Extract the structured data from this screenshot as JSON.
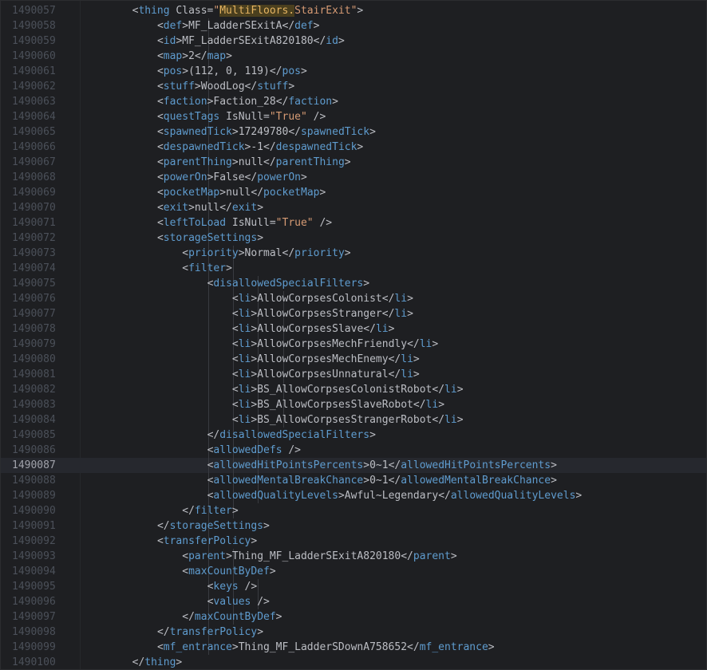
{
  "current_line": "1490087",
  "lines": [
    {
      "n": "1490057",
      "indent": 5,
      "parts": [
        [
          "br",
          "<"
        ],
        [
          "tag",
          "thing "
        ],
        [
          "attr",
          "Class="
        ],
        [
          "val",
          "\""
        ],
        [
          "hl",
          "MultiFloors."
        ],
        [
          "val",
          "StairExit\""
        ],
        [
          "br",
          ">"
        ]
      ]
    },
    {
      "n": "1490058",
      "indent": 6,
      "parts": [
        [
          "br",
          "<"
        ],
        [
          "tag",
          "def"
        ],
        [
          "br",
          ">"
        ],
        [
          "txt",
          "MF_LadderSExitA"
        ],
        [
          "br",
          "</"
        ],
        [
          "tag",
          "def"
        ],
        [
          "br",
          ">"
        ]
      ]
    },
    {
      "n": "1490059",
      "indent": 6,
      "parts": [
        [
          "br",
          "<"
        ],
        [
          "tag",
          "id"
        ],
        [
          "br",
          ">"
        ],
        [
          "txt",
          "MF_LadderSExitA820180"
        ],
        [
          "br",
          "</"
        ],
        [
          "tag",
          "id"
        ],
        [
          "br",
          ">"
        ]
      ]
    },
    {
      "n": "1490060",
      "indent": 6,
      "parts": [
        [
          "br",
          "<"
        ],
        [
          "tag",
          "map"
        ],
        [
          "br",
          ">"
        ],
        [
          "txt",
          "2"
        ],
        [
          "br",
          "</"
        ],
        [
          "tag",
          "map"
        ],
        [
          "br",
          ">"
        ]
      ]
    },
    {
      "n": "1490061",
      "indent": 6,
      "parts": [
        [
          "br",
          "<"
        ],
        [
          "tag",
          "pos"
        ],
        [
          "br",
          ">"
        ],
        [
          "txt",
          "(112, 0, 119)"
        ],
        [
          "br",
          "</"
        ],
        [
          "tag",
          "pos"
        ],
        [
          "br",
          ">"
        ]
      ]
    },
    {
      "n": "1490062",
      "indent": 6,
      "parts": [
        [
          "br",
          "<"
        ],
        [
          "tag",
          "stuff"
        ],
        [
          "br",
          ">"
        ],
        [
          "txt",
          "WoodLog"
        ],
        [
          "br",
          "</"
        ],
        [
          "tag",
          "stuff"
        ],
        [
          "br",
          ">"
        ]
      ]
    },
    {
      "n": "1490063",
      "indent": 6,
      "parts": [
        [
          "br",
          "<"
        ],
        [
          "tag",
          "faction"
        ],
        [
          "br",
          ">"
        ],
        [
          "txt",
          "Faction_28"
        ],
        [
          "br",
          "</"
        ],
        [
          "tag",
          "faction"
        ],
        [
          "br",
          ">"
        ]
      ]
    },
    {
      "n": "1490064",
      "indent": 6,
      "parts": [
        [
          "br",
          "<"
        ],
        [
          "tag",
          "questTags "
        ],
        [
          "attr",
          "IsNull="
        ],
        [
          "val",
          "\"True\""
        ],
        [
          "br",
          " />"
        ]
      ]
    },
    {
      "n": "1490065",
      "indent": 6,
      "parts": [
        [
          "br",
          "<"
        ],
        [
          "tag",
          "spawnedTick"
        ],
        [
          "br",
          ">"
        ],
        [
          "txt",
          "17249780"
        ],
        [
          "br",
          "</"
        ],
        [
          "tag",
          "spawnedTick"
        ],
        [
          "br",
          ">"
        ]
      ]
    },
    {
      "n": "1490066",
      "indent": 6,
      "parts": [
        [
          "br",
          "<"
        ],
        [
          "tag",
          "despawnedTick"
        ],
        [
          "br",
          ">"
        ],
        [
          "txt",
          "-1"
        ],
        [
          "br",
          "</"
        ],
        [
          "tag",
          "despawnedTick"
        ],
        [
          "br",
          ">"
        ]
      ]
    },
    {
      "n": "1490067",
      "indent": 6,
      "parts": [
        [
          "br",
          "<"
        ],
        [
          "tag",
          "parentThing"
        ],
        [
          "br",
          ">"
        ],
        [
          "txt",
          "null"
        ],
        [
          "br",
          "</"
        ],
        [
          "tag",
          "parentThing"
        ],
        [
          "br",
          ">"
        ]
      ]
    },
    {
      "n": "1490068",
      "indent": 6,
      "parts": [
        [
          "br",
          "<"
        ],
        [
          "tag",
          "powerOn"
        ],
        [
          "br",
          ">"
        ],
        [
          "txt",
          "False"
        ],
        [
          "br",
          "</"
        ],
        [
          "tag",
          "powerOn"
        ],
        [
          "br",
          ">"
        ]
      ]
    },
    {
      "n": "1490069",
      "indent": 6,
      "parts": [
        [
          "br",
          "<"
        ],
        [
          "tag",
          "pocketMap"
        ],
        [
          "br",
          ">"
        ],
        [
          "txt",
          "null"
        ],
        [
          "br",
          "</"
        ],
        [
          "tag",
          "pocketMap"
        ],
        [
          "br",
          ">"
        ]
      ]
    },
    {
      "n": "1490070",
      "indent": 6,
      "parts": [
        [
          "br",
          "<"
        ],
        [
          "tag",
          "exit"
        ],
        [
          "br",
          ">"
        ],
        [
          "txt",
          "null"
        ],
        [
          "br",
          "</"
        ],
        [
          "tag",
          "exit"
        ],
        [
          "br",
          ">"
        ]
      ]
    },
    {
      "n": "1490071",
      "indent": 6,
      "parts": [
        [
          "br",
          "<"
        ],
        [
          "tag",
          "leftToLoad "
        ],
        [
          "attr",
          "IsNull="
        ],
        [
          "val",
          "\"True\""
        ],
        [
          "br",
          " />"
        ]
      ]
    },
    {
      "n": "1490072",
      "indent": 6,
      "parts": [
        [
          "br",
          "<"
        ],
        [
          "tag",
          "storageSettings"
        ],
        [
          "br",
          ">"
        ]
      ]
    },
    {
      "n": "1490073",
      "indent": 7,
      "parts": [
        [
          "br",
          "<"
        ],
        [
          "tag",
          "priority"
        ],
        [
          "br",
          ">"
        ],
        [
          "txt",
          "Normal"
        ],
        [
          "br",
          "</"
        ],
        [
          "tag",
          "priority"
        ],
        [
          "br",
          ">"
        ]
      ]
    },
    {
      "n": "1490074",
      "indent": 7,
      "parts": [
        [
          "br",
          "<"
        ],
        [
          "tag",
          "filter"
        ],
        [
          "br",
          ">"
        ]
      ]
    },
    {
      "n": "1490075",
      "indent": 8,
      "parts": [
        [
          "br",
          "<"
        ],
        [
          "tag",
          "disallowedSpecialFilters"
        ],
        [
          "br",
          ">"
        ]
      ]
    },
    {
      "n": "1490076",
      "indent": 9,
      "parts": [
        [
          "br",
          "<"
        ],
        [
          "tag",
          "li"
        ],
        [
          "br",
          ">"
        ],
        [
          "txt",
          "AllowCorpsesColonist"
        ],
        [
          "br",
          "</"
        ],
        [
          "tag",
          "li"
        ],
        [
          "br",
          ">"
        ]
      ]
    },
    {
      "n": "1490077",
      "indent": 9,
      "parts": [
        [
          "br",
          "<"
        ],
        [
          "tag",
          "li"
        ],
        [
          "br",
          ">"
        ],
        [
          "txt",
          "AllowCorpsesStranger"
        ],
        [
          "br",
          "</"
        ],
        [
          "tag",
          "li"
        ],
        [
          "br",
          ">"
        ]
      ]
    },
    {
      "n": "1490078",
      "indent": 9,
      "parts": [
        [
          "br",
          "<"
        ],
        [
          "tag",
          "li"
        ],
        [
          "br",
          ">"
        ],
        [
          "txt",
          "AllowCorpsesSlave"
        ],
        [
          "br",
          "</"
        ],
        [
          "tag",
          "li"
        ],
        [
          "br",
          ">"
        ]
      ]
    },
    {
      "n": "1490079",
      "indent": 9,
      "parts": [
        [
          "br",
          "<"
        ],
        [
          "tag",
          "li"
        ],
        [
          "br",
          ">"
        ],
        [
          "txt",
          "AllowCorpsesMechFriendly"
        ],
        [
          "br",
          "</"
        ],
        [
          "tag",
          "li"
        ],
        [
          "br",
          ">"
        ]
      ]
    },
    {
      "n": "1490080",
      "indent": 9,
      "parts": [
        [
          "br",
          "<"
        ],
        [
          "tag",
          "li"
        ],
        [
          "br",
          ">"
        ],
        [
          "txt",
          "AllowCorpsesMechEnemy"
        ],
        [
          "br",
          "</"
        ],
        [
          "tag",
          "li"
        ],
        [
          "br",
          ">"
        ]
      ]
    },
    {
      "n": "1490081",
      "indent": 9,
      "parts": [
        [
          "br",
          "<"
        ],
        [
          "tag",
          "li"
        ],
        [
          "br",
          ">"
        ],
        [
          "txt",
          "AllowCorpsesUnnatural"
        ],
        [
          "br",
          "</"
        ],
        [
          "tag",
          "li"
        ],
        [
          "br",
          ">"
        ]
      ]
    },
    {
      "n": "1490082",
      "indent": 9,
      "parts": [
        [
          "br",
          "<"
        ],
        [
          "tag",
          "li"
        ],
        [
          "br",
          ">"
        ],
        [
          "txt",
          "BS_AllowCorpsesColonistRobot"
        ],
        [
          "br",
          "</"
        ],
        [
          "tag",
          "li"
        ],
        [
          "br",
          ">"
        ]
      ]
    },
    {
      "n": "1490083",
      "indent": 9,
      "parts": [
        [
          "br",
          "<"
        ],
        [
          "tag",
          "li"
        ],
        [
          "br",
          ">"
        ],
        [
          "txt",
          "BS_AllowCorpsesSlaveRobot"
        ],
        [
          "br",
          "</"
        ],
        [
          "tag",
          "li"
        ],
        [
          "br",
          ">"
        ]
      ]
    },
    {
      "n": "1490084",
      "indent": 9,
      "parts": [
        [
          "br",
          "<"
        ],
        [
          "tag",
          "li"
        ],
        [
          "br",
          ">"
        ],
        [
          "txt",
          "BS_AllowCorpsesStrangerRobot"
        ],
        [
          "br",
          "</"
        ],
        [
          "tag",
          "li"
        ],
        [
          "br",
          ">"
        ]
      ]
    },
    {
      "n": "1490085",
      "indent": 8,
      "parts": [
        [
          "br",
          "</"
        ],
        [
          "tag",
          "disallowedSpecialFilters"
        ],
        [
          "br",
          ">"
        ]
      ]
    },
    {
      "n": "1490086",
      "indent": 8,
      "parts": [
        [
          "br",
          "<"
        ],
        [
          "tag",
          "allowedDefs"
        ],
        [
          "br",
          " />"
        ]
      ]
    },
    {
      "n": "1490087",
      "indent": 8,
      "parts": [
        [
          "br",
          "<"
        ],
        [
          "tag",
          "allowedHitPointsPercents"
        ],
        [
          "br",
          ">"
        ],
        [
          "txt",
          "0~1"
        ],
        [
          "br",
          "</"
        ],
        [
          "tag",
          "allowedHitPointsPercents"
        ],
        [
          "br",
          ">"
        ]
      ]
    },
    {
      "n": "1490088",
      "indent": 8,
      "parts": [
        [
          "br",
          "<"
        ],
        [
          "tag",
          "allowedMentalBreakChance"
        ],
        [
          "br",
          ">"
        ],
        [
          "txt",
          "0~1"
        ],
        [
          "br",
          "</"
        ],
        [
          "tag",
          "allowedMentalBreakChance"
        ],
        [
          "br",
          ">"
        ]
      ]
    },
    {
      "n": "1490089",
      "indent": 8,
      "parts": [
        [
          "br",
          "<"
        ],
        [
          "tag",
          "allowedQualityLevels"
        ],
        [
          "br",
          ">"
        ],
        [
          "txt",
          "Awful~Legendary"
        ],
        [
          "br",
          "</"
        ],
        [
          "tag",
          "allowedQualityLevels"
        ],
        [
          "br",
          ">"
        ]
      ]
    },
    {
      "n": "1490090",
      "indent": 7,
      "parts": [
        [
          "br",
          "</"
        ],
        [
          "tag",
          "filter"
        ],
        [
          "br",
          ">"
        ]
      ]
    },
    {
      "n": "1490091",
      "indent": 6,
      "parts": [
        [
          "br",
          "</"
        ],
        [
          "tag",
          "storageSettings"
        ],
        [
          "br",
          ">"
        ]
      ]
    },
    {
      "n": "1490092",
      "indent": 6,
      "parts": [
        [
          "br",
          "<"
        ],
        [
          "tag",
          "transferPolicy"
        ],
        [
          "br",
          ">"
        ]
      ]
    },
    {
      "n": "1490093",
      "indent": 7,
      "parts": [
        [
          "br",
          "<"
        ],
        [
          "tag",
          "parent"
        ],
        [
          "br",
          ">"
        ],
        [
          "txt",
          "Thing_MF_LadderSExitA820180"
        ],
        [
          "br",
          "</"
        ],
        [
          "tag",
          "parent"
        ],
        [
          "br",
          ">"
        ]
      ]
    },
    {
      "n": "1490094",
      "indent": 7,
      "parts": [
        [
          "br",
          "<"
        ],
        [
          "tag",
          "maxCountByDef"
        ],
        [
          "br",
          ">"
        ]
      ]
    },
    {
      "n": "1490095",
      "indent": 8,
      "parts": [
        [
          "br",
          "<"
        ],
        [
          "tag",
          "keys"
        ],
        [
          "br",
          " />"
        ]
      ]
    },
    {
      "n": "1490096",
      "indent": 8,
      "parts": [
        [
          "br",
          "<"
        ],
        [
          "tag",
          "values"
        ],
        [
          "br",
          " />"
        ]
      ]
    },
    {
      "n": "1490097",
      "indent": 7,
      "parts": [
        [
          "br",
          "</"
        ],
        [
          "tag",
          "maxCountByDef"
        ],
        [
          "br",
          ">"
        ]
      ]
    },
    {
      "n": "1490098",
      "indent": 6,
      "parts": [
        [
          "br",
          "</"
        ],
        [
          "tag",
          "transferPolicy"
        ],
        [
          "br",
          ">"
        ]
      ]
    },
    {
      "n": "1490099",
      "indent": 6,
      "parts": [
        [
          "br",
          "<"
        ],
        [
          "tag",
          "mf_entrance"
        ],
        [
          "br",
          ">"
        ],
        [
          "txt",
          "Thing_MF_LadderSDownA758652"
        ],
        [
          "br",
          "</"
        ],
        [
          "tag",
          "mf_entrance"
        ],
        [
          "br",
          ">"
        ]
      ]
    },
    {
      "n": "1490100",
      "indent": 5,
      "parts": [
        [
          "br",
          "</"
        ],
        [
          "tag",
          "thing"
        ],
        [
          "br",
          ">"
        ]
      ]
    }
  ],
  "colors": {
    "background": "#1e1f22",
    "tag": "#5f9ccf",
    "text": "#bcbec4",
    "attr_value": "#d79b74",
    "highlight_bg": "#4a3f1e",
    "line_number": "#4b5059",
    "current_line_number": "#a1a3ab"
  }
}
